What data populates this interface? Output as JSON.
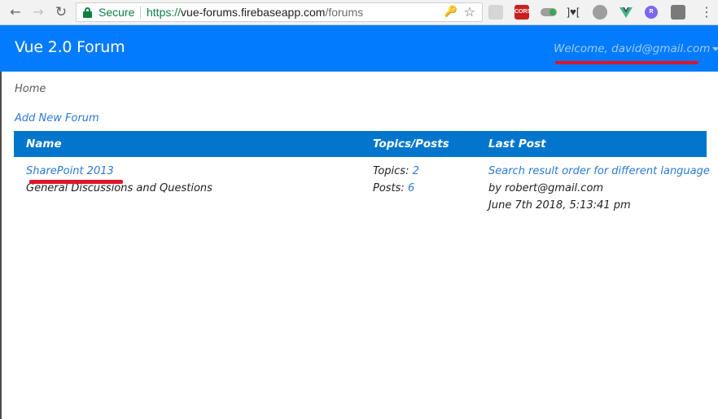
{
  "browser": {
    "secure_label": "Secure",
    "url_scheme": "https://",
    "url_host": "vue-forums.firebaseapp.com",
    "url_path": "/forums",
    "extensions": [
      "",
      "CORS",
      "",
      "]♥[",
      "",
      "",
      "R",
      ""
    ]
  },
  "navbar": {
    "brand": "Vue 2.0 Forum",
    "welcome": "Welcome, david@gmail.com"
  },
  "breadcrumb": "Home",
  "add_forum_label": "Add New Forum",
  "table": {
    "headers": {
      "name": "Name",
      "topics_posts": "Topics/Posts",
      "last_post": "Last Post"
    },
    "rows": [
      {
        "name": "SharePoint 2013",
        "description": "General Discussions and Questions",
        "topics_label": "Topics:",
        "topics_count": "2",
        "posts_label": "Posts:",
        "posts_count": "6",
        "last_post_title": "Search result order for different language",
        "last_post_by": "by robert@gmail.com",
        "last_post_date": "June 7th 2018, 5:13:41 pm"
      }
    ]
  },
  "colors": {
    "navbar": "#027bff",
    "table_header": "#0275cc",
    "link": "#2a7ad6",
    "annotation_mark": "#e0152a"
  }
}
